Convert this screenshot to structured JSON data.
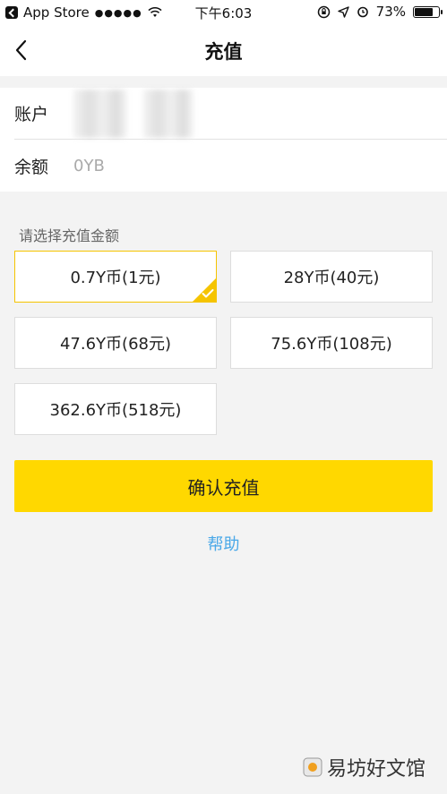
{
  "status_bar": {
    "carrier": "App Store",
    "signal": "●●●●●",
    "time": "下午6:03",
    "battery": "73%"
  },
  "nav": {
    "title": "充值"
  },
  "account": {
    "account_label": "账户",
    "balance_label": "余额",
    "balance_value": "0YB"
  },
  "section_label": "请选择充值金额",
  "options": [
    {
      "label": "0.7Y币(1元)",
      "selected": true
    },
    {
      "label": "28Y币(40元)",
      "selected": false
    },
    {
      "label": "47.6Y币(68元)",
      "selected": false
    },
    {
      "label": "75.6Y币(108元)",
      "selected": false
    },
    {
      "label": "362.6Y币(518元)",
      "selected": false
    }
  ],
  "confirm_label": "确认充值",
  "help_label": "帮助",
  "watermark": "易坊好文馆",
  "colors": {
    "accent": "#ffd800",
    "selected_border": "#f5c400",
    "link": "#4aa8e8"
  }
}
